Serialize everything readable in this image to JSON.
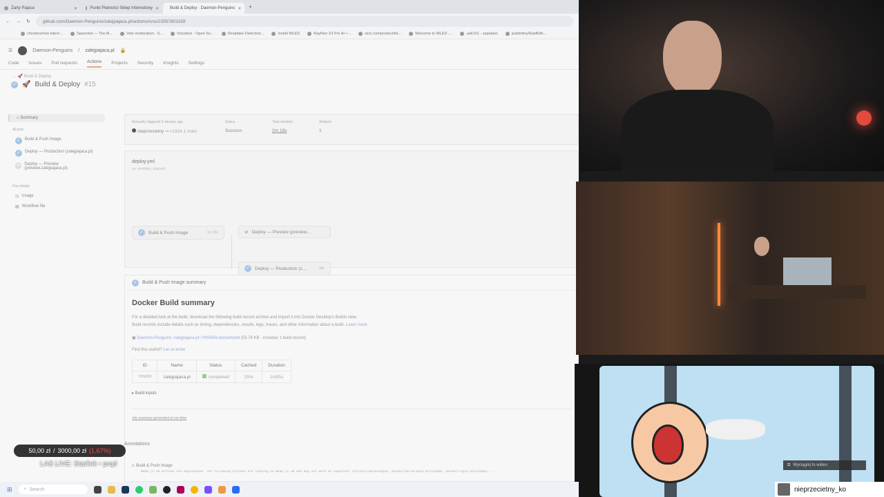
{
  "browser": {
    "tabs": [
      {
        "label": "Żarty Pajaca"
      },
      {
        "label": "Punkt Płatności Sklep Internetowy"
      },
      {
        "label": "Build & Deploy · Daemon-Penguins"
      }
    ],
    "new_tab": "+",
    "url": "github.com/Daemon-Penguins/zalejpajaca.pl/actions/runs/23557801159",
    "bookmarks": [
      "chromez//net-intern...",
      "Spacebot — The Al...",
      "Vote moderation - S...",
      "Voicebox - Open So...",
      "Deepfake Detection...",
      "Install WLED",
      "RayNeo X3 Pro AI +...",
      "sick.com/product/kk...",
      "Welcome to WLED -...",
      "ua6101 - zapakalo",
      "justdmitry/RaidKith..."
    ]
  },
  "github": {
    "org": "Daemon-Penguins",
    "repo": "zalejpajaca.pl",
    "nav": [
      "Code",
      "Issues",
      "Pull requests",
      "Actions",
      "Projects",
      "Security",
      "Insights",
      "Settings"
    ],
    "breadcrumb": "Build & Deploy",
    "run_title": "Build & Deploy",
    "run_number": "#15"
  },
  "sidebar": {
    "summary": "Summary",
    "all_jobs": "All jobs",
    "jobs": [
      "Build & Push Image",
      "Deploy — Production (zalejpajaca.pl)",
      "Deploy — Preview (preview.zalejpajaca.pl)"
    ],
    "run_details": "Run details",
    "details": [
      "Usage",
      "Workflow file"
    ]
  },
  "run_meta": {
    "trigger_label": "Manually triggered 3 minutes ago",
    "actor": "nieprzecietny",
    "commit": "c1916.1",
    "branch": "main",
    "status_label": "Status",
    "status": "Success",
    "duration_label": "Total duration",
    "duration": "2m 18s",
    "artifacts_label": "Artifacts",
    "artifacts": "1"
  },
  "workflow": {
    "file": "deploy.yml",
    "event": "on: workflow_dispatch",
    "jobs": [
      {
        "label": "Build & Push Image",
        "time": "1m 30s"
      },
      {
        "label": "Deploy — Preview (preview...",
        "time": ""
      },
      {
        "label": "Deploy — Production (z...",
        "time": "38s"
      }
    ]
  },
  "summary": {
    "section_title": "Build & Push Image summary",
    "heading": "Docker Build summary",
    "para1": "For a detailed look at the build, download the following build record archive and import it into Docker Desktop's Builds view.",
    "para2": "Build records include details such as timing, dependencies, results, logs, traces, and other information about a build.",
    "learn_more": "Learn more",
    "archive_link": "Daemon-Penguins~zalejpajaca.pl~YNSN59.dockerbuild",
    "archive_meta": "(53.76 KB · includes 1 build record)",
    "useful": "Find this useful?",
    "let_us_know": "Let us know",
    "table": {
      "headers": [
        "ID",
        "Name",
        "Status",
        "Cached",
        "Duration"
      ],
      "rows": [
        [
          "YNSN59",
          "zalejpajaca.pl",
          "completed",
          "25%",
          "1m05s"
        ]
      ]
    },
    "build_inputs": "Build inputs",
    "footer": "Job summary generated at run-time"
  },
  "annotations": {
    "title": "Annotations",
    "item": "Build & Push Image",
    "warning": "Node.js 20 actions are deprecated. The following actions are running on Node.js 20 and may not work as expected: actions/checkout@v4, docker/build-push-action@v6, docker/login-action@v3, ..."
  },
  "overlay": {
    "ticker_amount": "50,00 zł",
    "ticker_goal": "3000,00 zł",
    "ticker_pct": "(1.67%)",
    "live_text": "LAS LIVE: Starlink • prqd",
    "popout": "Wyciągnij to wideo",
    "viewer": "nieprzecietny_ko"
  },
  "taskbar": {
    "search": "Search"
  }
}
